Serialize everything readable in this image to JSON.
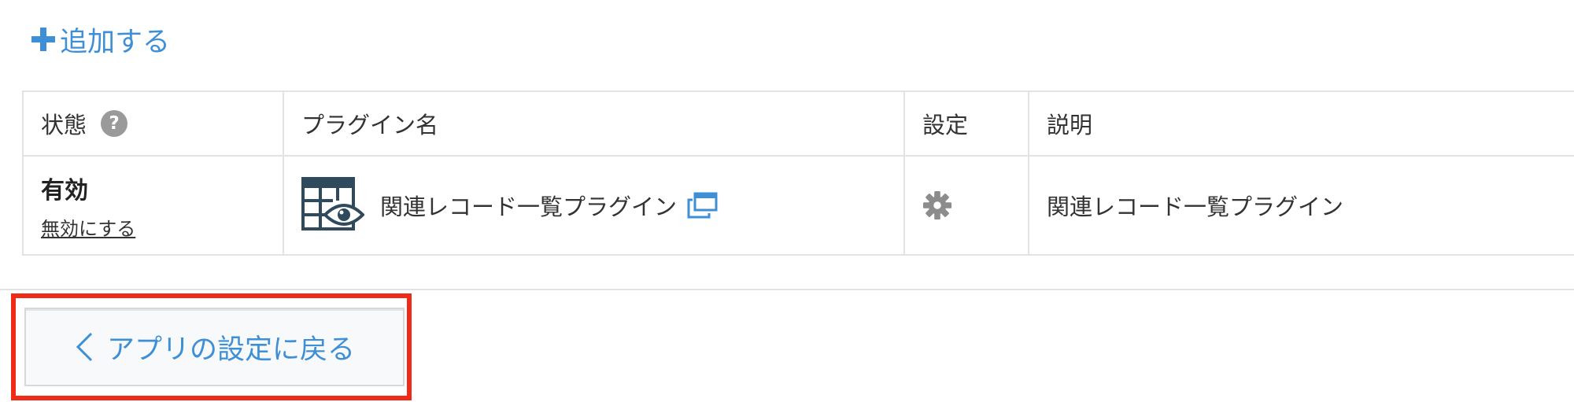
{
  "actions": {
    "add_label": "追加する"
  },
  "table": {
    "headers": {
      "status": "状態",
      "plugin_name": "プラグイン名",
      "setting": "設定",
      "description": "説明"
    },
    "rows": [
      {
        "status": "有効",
        "toggle_link": "無効にする",
        "plugin_name": "関連レコード一覧プラグイン",
        "description": "関連レコード一覧プラグイン"
      }
    ]
  },
  "footer": {
    "back_label": "アプリの設定に戻る"
  },
  "icons": {
    "add": "plus-icon",
    "help": "help-icon",
    "plugin_logo": "table-view-icon",
    "open_new_window": "new-window-icon",
    "settings": "gear-icon",
    "back": "chevron-left-icon"
  },
  "colors": {
    "link_blue": "#3f8fd6",
    "logo_navy": "#2f4a5c",
    "highlight_red": "#f02a16",
    "icon_gray": "#9a9a9a"
  }
}
